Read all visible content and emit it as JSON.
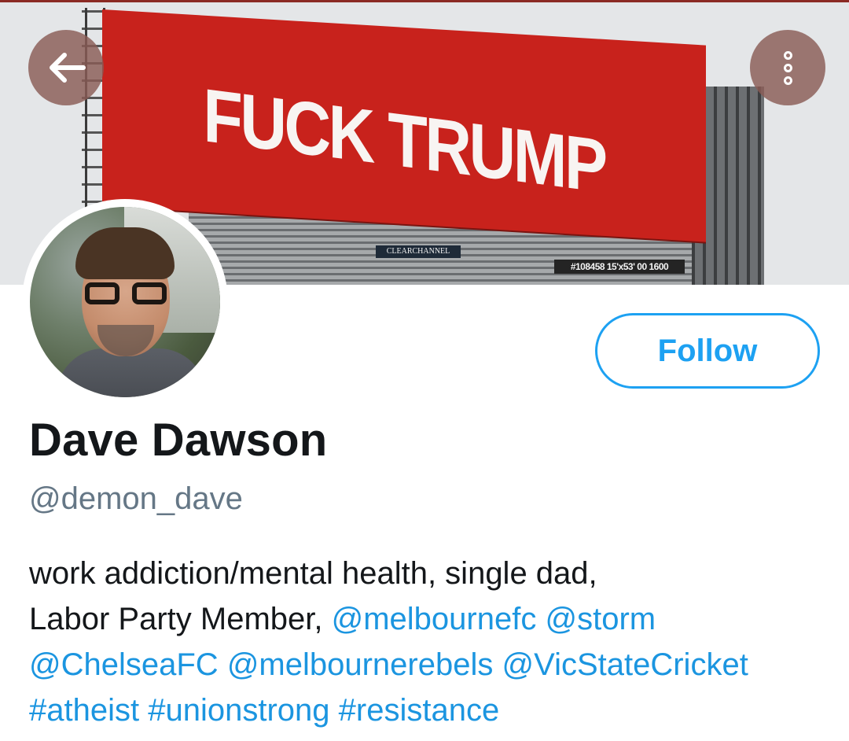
{
  "banner": {
    "billboard_text": "FUCK TRUMP",
    "sponsor_plate": "CLEARCHANNEL",
    "id_plate": "#108458 15'x53' 00 1600"
  },
  "header_buttons": {
    "back_icon": "arrow-left-icon",
    "more_icon": "more-vertical-icon"
  },
  "profile": {
    "display_name": "Dave Dawson",
    "handle": "@demon_dave",
    "follow_label": "Follow"
  },
  "bio": {
    "line1": "work addiction/mental health, single dad,",
    "line2_text": "Labor Party Member,",
    "mention_melbournefc": "@melbournefc",
    "mention_storm": "@storm",
    "mention_chelseafc": "@ChelseaFC",
    "mention_melbournerebels": "@melbournerebels",
    "mention_vicstatecricket": "@VicStateCricket",
    "tag_atheist": "#atheist",
    "tag_unionstrong": "#unionstrong",
    "tag_resistance": "#resistance"
  },
  "colors": {
    "accent": "#1da1f2",
    "link": "#1b95e0",
    "text_primary": "#14171a",
    "text_secondary": "#657786",
    "billboard_red": "#c8221c"
  }
}
